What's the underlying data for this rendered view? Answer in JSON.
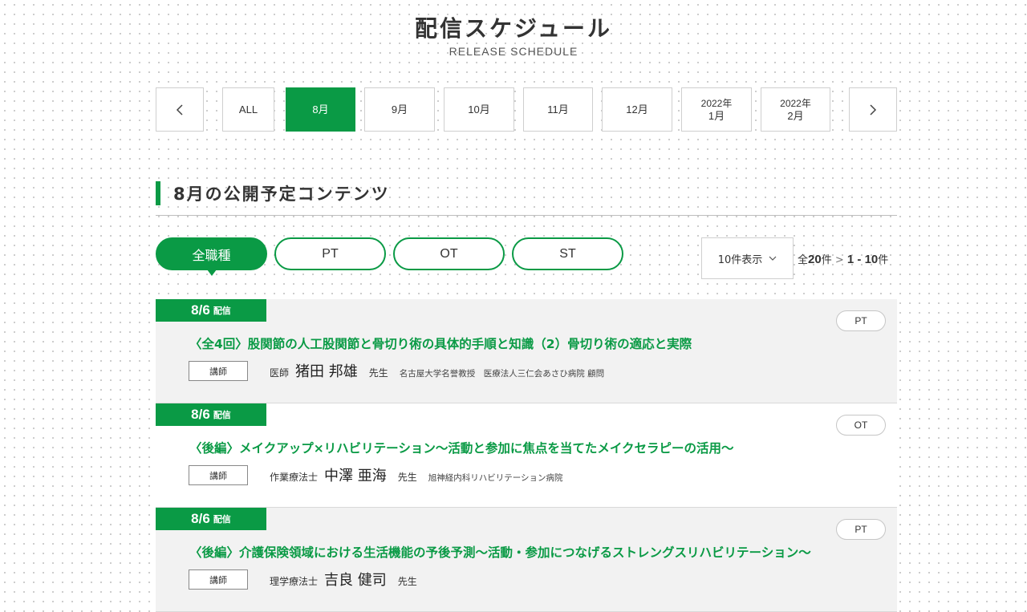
{
  "header": {
    "title": "配信スケジュール",
    "subtitle": "RELEASE SCHEDULE"
  },
  "month_nav": {
    "prev_icon": "chevron-left-icon",
    "next_icon": "chevron-right-icon",
    "months": [
      {
        "line1": "ALL",
        "line2": "",
        "active": false
      },
      {
        "line1": "8月",
        "line2": "",
        "active": true
      },
      {
        "line1": "9月",
        "line2": "",
        "active": false
      },
      {
        "line1": "10月",
        "line2": "",
        "active": false
      },
      {
        "line1": "11月",
        "line2": "",
        "active": false
      },
      {
        "line1": "12月",
        "line2": "",
        "active": false
      },
      {
        "line1": "2022年",
        "line2": "1月",
        "active": false
      },
      {
        "line1": "2022年",
        "line2": "2月",
        "active": false
      }
    ]
  },
  "section": {
    "title": "8月の公開予定コンテンツ"
  },
  "filters": [
    {
      "label": "全職種",
      "active": true
    },
    {
      "label": "PT",
      "active": false
    },
    {
      "label": "OT",
      "active": false
    },
    {
      "label": "ST",
      "active": false
    }
  ],
  "per_page": {
    "label": "10件表示"
  },
  "counts": {
    "prefix": "全",
    "total": "20",
    "unit1": "件",
    "sep": ">",
    "range": "1 - 10",
    "unit2": "件"
  },
  "items": [
    {
      "date": "8/6",
      "date_suffix": "配信",
      "category": "PT",
      "title": "〈全4回〉股関節の人工股関節と骨切り術の具体的手順と知識（2）骨切り術の適応と実際",
      "lecturer_label": "講師",
      "role": "医師",
      "name": "猪田 邦雄",
      "honorific": "先生",
      "affiliation": "名古屋大学名誉教授　医療法人三仁会あさひ病院 顧問"
    },
    {
      "date": "8/6",
      "date_suffix": "配信",
      "category": "OT",
      "title": "〈後編〉メイクアップ×リハビリテーション〜活動と参加に焦点を当てたメイクセラピーの活用〜",
      "lecturer_label": "講師",
      "role": "作業療法士",
      "name": "中澤 亜海",
      "honorific": "先生",
      "affiliation": "旭神経内科リハビリテーション病院"
    },
    {
      "date": "8/6",
      "date_suffix": "配信",
      "category": "PT",
      "title": "〈後編〉介護保険領域における生活機能の予後予測〜活動・参加につなげるストレングスリハビリテーション〜",
      "lecturer_label": "講師",
      "role": "理学療法士",
      "name": "吉良 健司",
      "honorific": "先生",
      "affiliation": ""
    }
  ]
}
